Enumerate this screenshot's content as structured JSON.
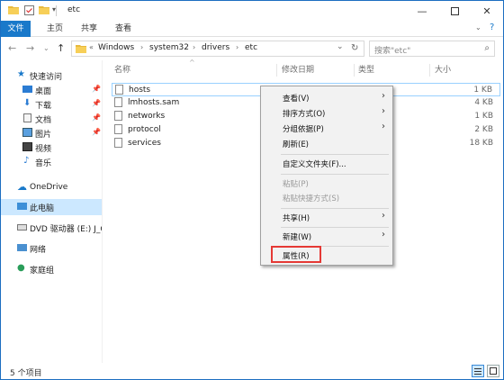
{
  "window": {
    "title": "etc"
  },
  "ribbon": {
    "tabs": [
      "文件",
      "主页",
      "共享",
      "查看"
    ]
  },
  "address": {
    "overflow": "«",
    "crumbs": [
      "Windows",
      "system32",
      "drivers",
      "etc"
    ],
    "search_placeholder": "搜索\"etc\""
  },
  "sidebar": {
    "items": [
      {
        "label": "快速访问",
        "icon": "star-icon"
      },
      {
        "label": "桌面",
        "icon": "desktop-icon",
        "pinned": true
      },
      {
        "label": "下载",
        "icon": "download-icon",
        "pinned": true
      },
      {
        "label": "文档",
        "icon": "document-icon",
        "pinned": true
      },
      {
        "label": "图片",
        "icon": "picture-icon",
        "pinned": true
      },
      {
        "label": "视频",
        "icon": "video-icon"
      },
      {
        "label": "音乐",
        "icon": "music-icon"
      },
      {
        "label": "OneDrive",
        "icon": "cloud-icon"
      },
      {
        "label": "此电脑",
        "icon": "computer-icon",
        "selected": true
      },
      {
        "label": "DVD 驱动器 (E:) J_C",
        "icon": "dvd-icon"
      },
      {
        "label": "网络",
        "icon": "network-icon"
      },
      {
        "label": "家庭组",
        "icon": "homegroup-icon"
      }
    ]
  },
  "columns": {
    "name": "名称",
    "date": "修改日期",
    "type": "类型",
    "size": "大小"
  },
  "files": [
    {
      "name": "hosts",
      "size": "1 KB"
    },
    {
      "name": "lmhosts.sam",
      "size": "4 KB"
    },
    {
      "name": "networks",
      "size": "1 KB"
    },
    {
      "name": "protocol",
      "size": "2 KB"
    },
    {
      "name": "services",
      "size": "18 KB"
    }
  ],
  "context_menu": {
    "view": "查看(V)",
    "sort": "排序方式(O)",
    "group": "分组依据(P)",
    "refresh": "刷新(E)",
    "customize": "自定义文件夹(F)...",
    "paste": "粘贴(P)",
    "paste_shortcut": "粘贴快捷方式(S)",
    "share": "共享(H)",
    "new": "新建(W)",
    "properties": "属性(R)"
  },
  "status": {
    "item_count": "5 个项目"
  },
  "colors": {
    "accent": "#1979ca",
    "highlight_box": "#e53935",
    "selection": "#cce8ff"
  }
}
